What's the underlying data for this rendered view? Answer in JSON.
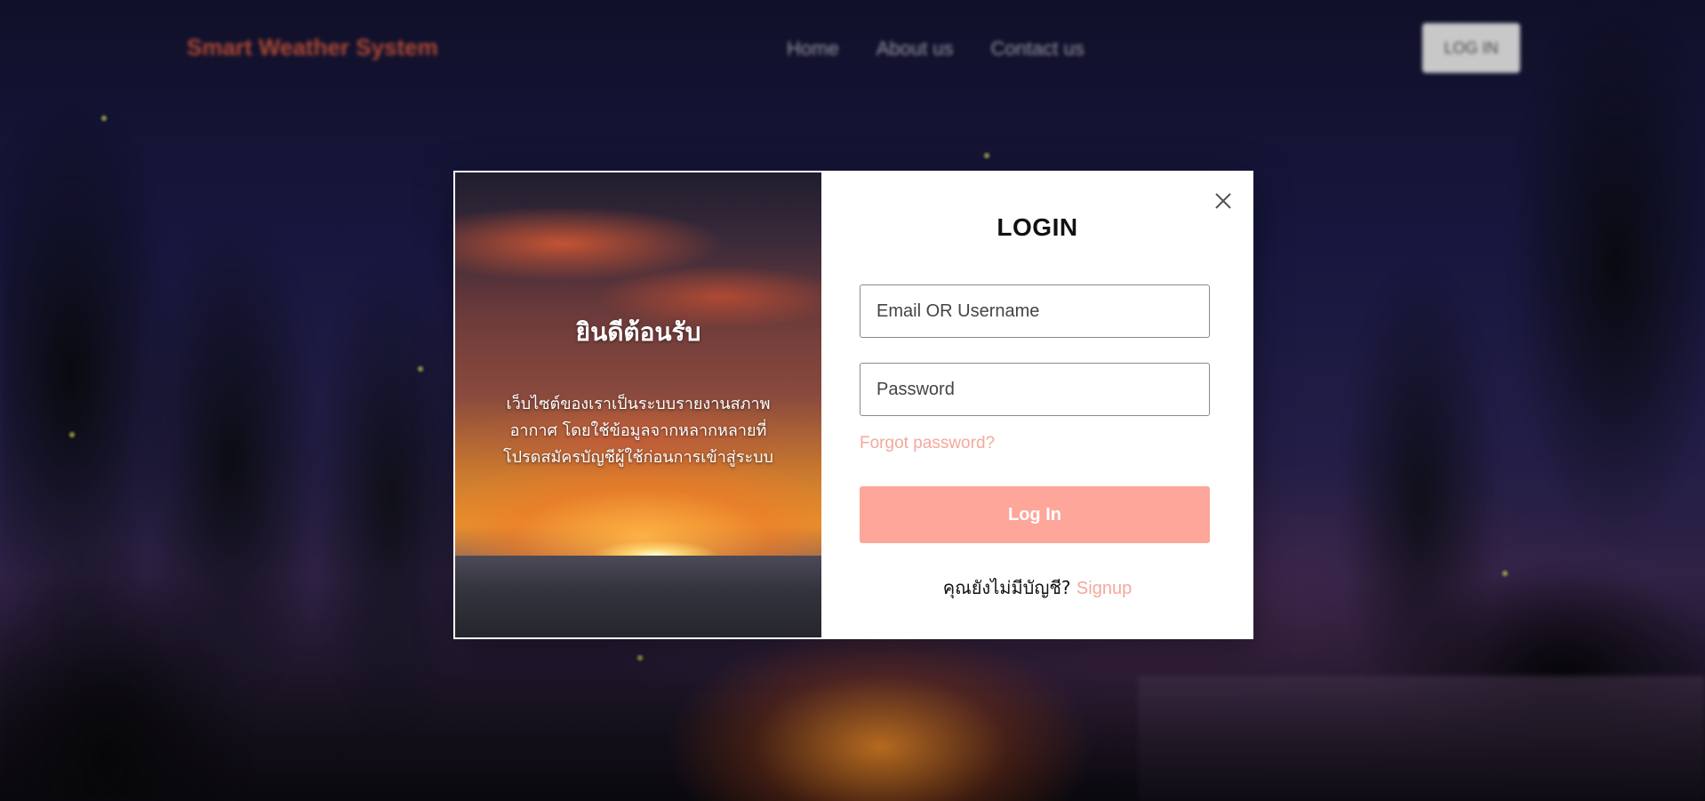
{
  "header": {
    "brand": "Smart Weather System",
    "nav": [
      "Home",
      "About us",
      "Contact us"
    ],
    "login_button": "LOG IN"
  },
  "modal": {
    "welcome_title": "ยินดีต้อนรับ",
    "welcome_text": "เว็บไซต์ของเราเป็นระบบรายงานสภาพอากาศ โดยใช้ข้อมูลจากหลากหลายที่ โปรดสมัครบัญชีผู้ใช้ก่อนการเข้าสู่ระบบ",
    "form_title": "LOGIN",
    "email_placeholder": "Email OR Username",
    "password_placeholder": "Password",
    "forgot_password": "Forgot password?",
    "submit_label": "Log In",
    "no_account_text": "คุณยังไม่มีบัญชี?",
    "signup_link": "Signup",
    "close_icon": "close-icon"
  },
  "colors": {
    "accent": "#fea69a",
    "link": "#f4a89c",
    "brand": "#d4593f"
  }
}
